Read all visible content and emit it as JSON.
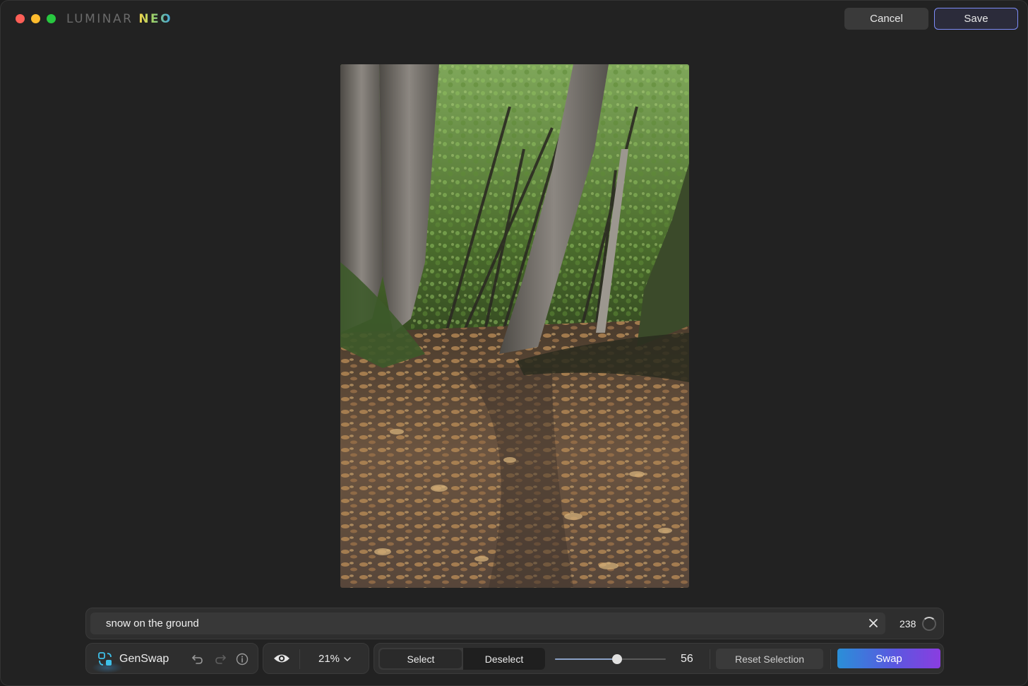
{
  "app": {
    "logo_part1": "LUMINAR",
    "logo_part2": "NEO"
  },
  "header": {
    "cancel_label": "Cancel",
    "save_label": "Save"
  },
  "prompt": {
    "value": "snow on the ground",
    "char_count": "238"
  },
  "toolbar": {
    "tool_name": "GenSwap",
    "zoom": "21%",
    "select_label": "Select",
    "deselect_label": "Deselect",
    "brush_size": "56",
    "brush_size_fraction": 0.56,
    "reset_label": "Reset Selection",
    "swap_label": "Swap"
  },
  "colors": {
    "save_border": "#7d8cf7",
    "swap_gradient_start": "#2a8fd8",
    "swap_gradient_end": "#8a3de0",
    "tool_icon": "#3ec0e8"
  },
  "icons": {
    "tool": "genswap-icon",
    "undo": "undo-icon",
    "redo": "redo-icon",
    "info": "info-icon",
    "preview": "eye-icon",
    "zoom_menu": "chevron-down-icon",
    "clear": "close-icon"
  }
}
